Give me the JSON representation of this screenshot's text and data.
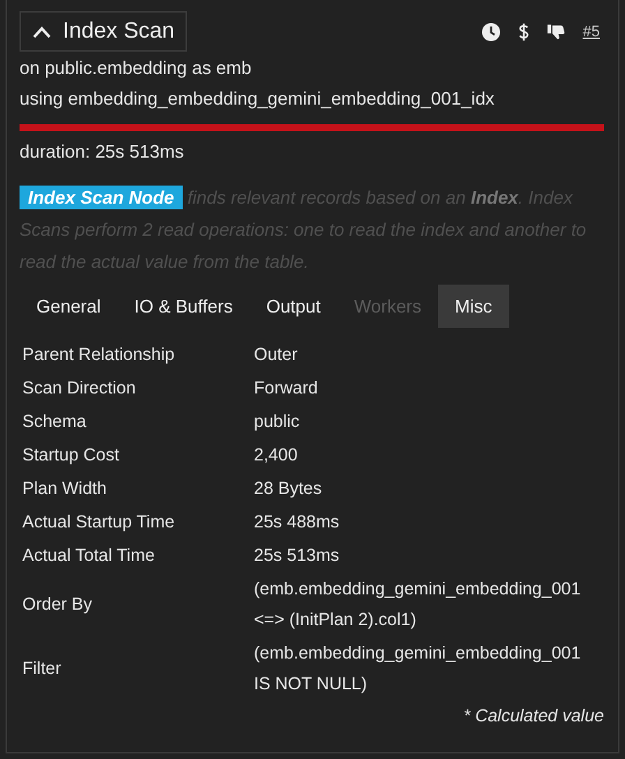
{
  "node": {
    "title": "Index Scan",
    "expanded": true,
    "link": "#5",
    "relation": "on public.embedding as emb",
    "index": "using embedding_embedding_gemini_embedding_001_idx"
  },
  "duration": {
    "level": 1.0,
    "label": "duration: 25s 513ms"
  },
  "description": {
    "badge": "Index Scan Node",
    "text": "finds relevant records based on an **Index**. Index Scans perform 2 read operations: one to read the index and another to read the actual value from the table."
  },
  "tabs": [
    {
      "label": "General",
      "selected": false,
      "disabled": false
    },
    {
      "label": "IO & Buffers",
      "selected": false,
      "disabled": false
    },
    {
      "label": "Output",
      "selected": false,
      "disabled": false
    },
    {
      "label": "Workers",
      "selected": false,
      "disabled": true
    },
    {
      "label": "Misc",
      "selected": true,
      "disabled": false
    }
  ],
  "properties": [
    {
      "name": "Parent Relationship",
      "value": "Outer"
    },
    {
      "name": "Scan Direction",
      "value": "Forward"
    },
    {
      "name": "Schema",
      "value": "public"
    },
    {
      "name": "Startup Cost",
      "value": "2,400"
    },
    {
      "name": "Plan Width",
      "value": "28 Bytes"
    },
    {
      "name": "Actual Startup Time",
      "value": "25s 488ms"
    },
    {
      "name": "Actual Total Time",
      "value": "25s 513ms"
    },
    {
      "name": "Order By",
      "value": "(emb.embedding_gemini_embedding_001 <=> (InitPlan 2).col1)"
    },
    {
      "name": "Filter",
      "value": "(emb.embedding_gemini_embedding_001 IS NOT NULL)"
    }
  ],
  "footnote": "* Calculated value"
}
